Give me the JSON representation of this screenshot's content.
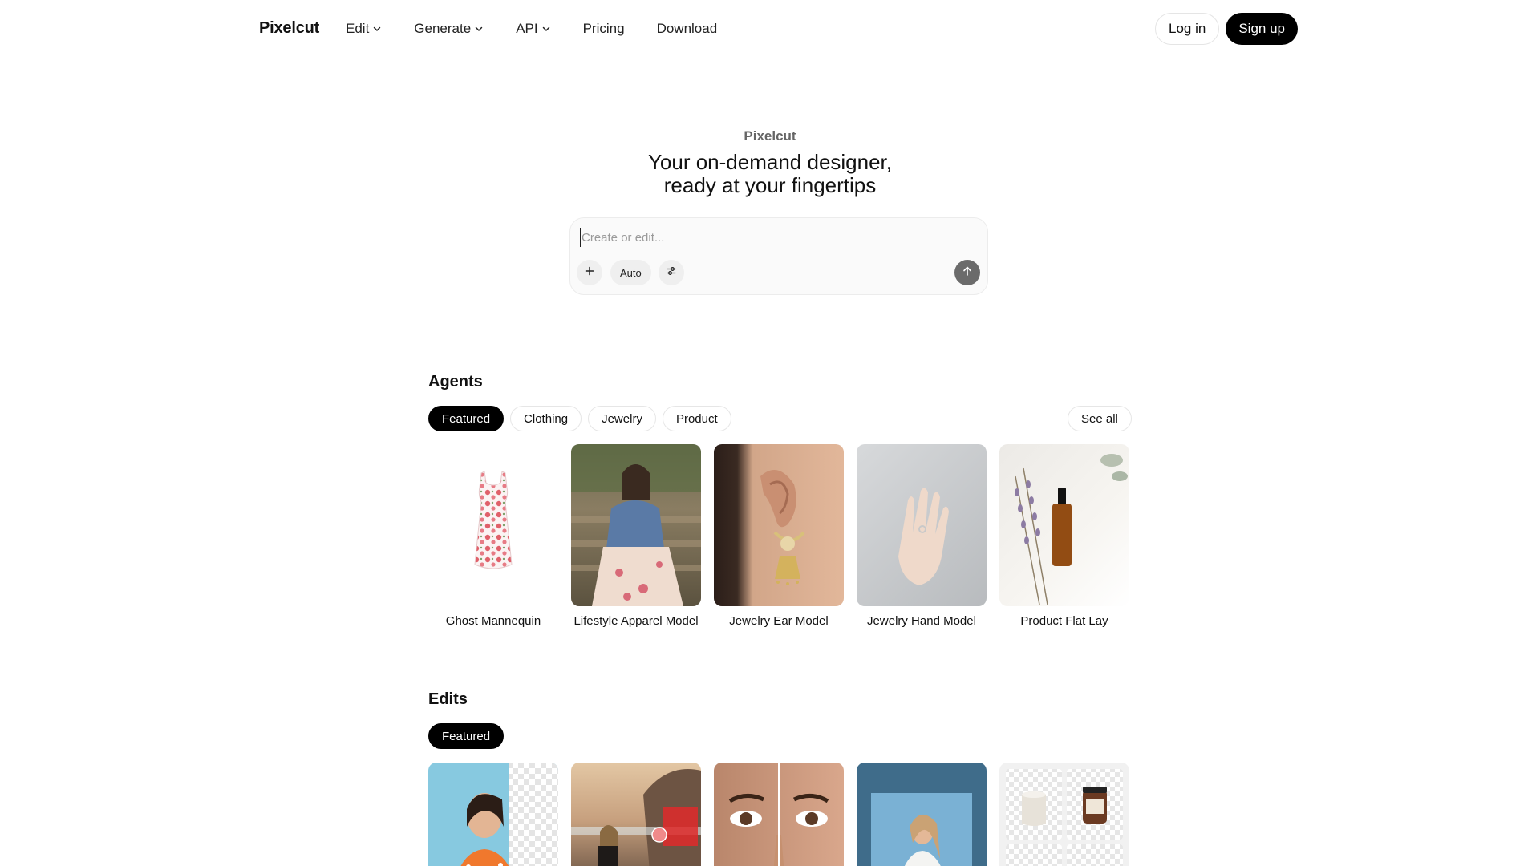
{
  "brand": {
    "logo_text": "Pixelcut"
  },
  "nav": {
    "items": [
      {
        "label": "Edit",
        "has_dropdown": true,
        "icon": "chevron-down-icon"
      },
      {
        "label": "Generate",
        "has_dropdown": true,
        "icon": "chevron-down-icon"
      },
      {
        "label": "API",
        "has_dropdown": true,
        "icon": "chevron-down-icon"
      },
      {
        "label": "Pricing",
        "has_dropdown": false
      },
      {
        "label": "Download",
        "has_dropdown": false
      }
    ]
  },
  "auth": {
    "login_label": "Log in",
    "signup_label": "Sign up"
  },
  "hero": {
    "eyebrow": "Pixelcut",
    "title_line1": "Your on-demand designer,",
    "title_line2": "ready at your fingertips"
  },
  "prompt": {
    "placeholder": "Create or edit...",
    "value": "",
    "add_icon": "plus-icon",
    "mode_label": "Auto",
    "settings_icon": "sliders-icon",
    "send_icon": "arrow-up-icon"
  },
  "agents": {
    "title": "Agents",
    "chips": [
      {
        "label": "Featured",
        "active": true
      },
      {
        "label": "Clothing",
        "active": false
      },
      {
        "label": "Jewelry",
        "active": false
      },
      {
        "label": "Product",
        "active": false
      }
    ],
    "see_all_label": "See all",
    "cards": [
      {
        "label": "Ghost Mannequin"
      },
      {
        "label": "Lifestyle Apparel Model"
      },
      {
        "label": "Jewelry Ear Model"
      },
      {
        "label": "Jewelry Hand Model"
      },
      {
        "label": "Product Flat Lay"
      }
    ]
  },
  "edits": {
    "title": "Edits",
    "chips": [
      {
        "label": "Featured",
        "active": true
      }
    ]
  },
  "colors": {
    "primary": "#000000",
    "background": "#ffffff",
    "chip_border": "#e6e6e6",
    "muted_text": "#666666",
    "send_button": "#6b6b6b"
  }
}
